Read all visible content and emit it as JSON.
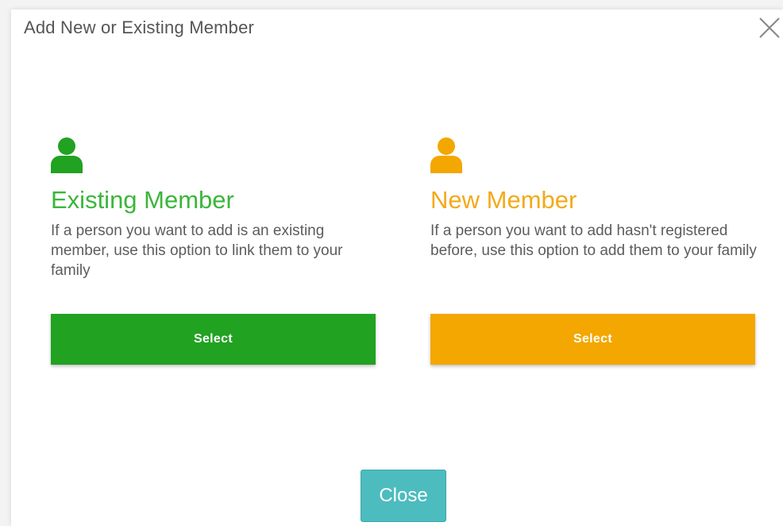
{
  "dialog": {
    "title": "Add New or Existing Member",
    "close_icon": "close-x-icon",
    "close_button_label": "Close"
  },
  "options": {
    "existing": {
      "icon": "person-icon",
      "icon_color": "#21a221",
      "title_word1": "Existing",
      "title_word2": "Member",
      "description": "If a person you want to add is an existing member, use this option to link them to your family",
      "button_label": "Select",
      "button_color": "#21a221"
    },
    "new": {
      "icon": "person-icon",
      "icon_color": "#f3a700",
      "title_word1": "New",
      "title_word2": "Member",
      "description": "If a person you want to add hasn't registered before, use this option to add them to your family",
      "button_label": "Select",
      "button_color": "#f3a700"
    }
  },
  "colors": {
    "close_button": "#4cbcbf",
    "text_muted": "#5c5c5c"
  }
}
